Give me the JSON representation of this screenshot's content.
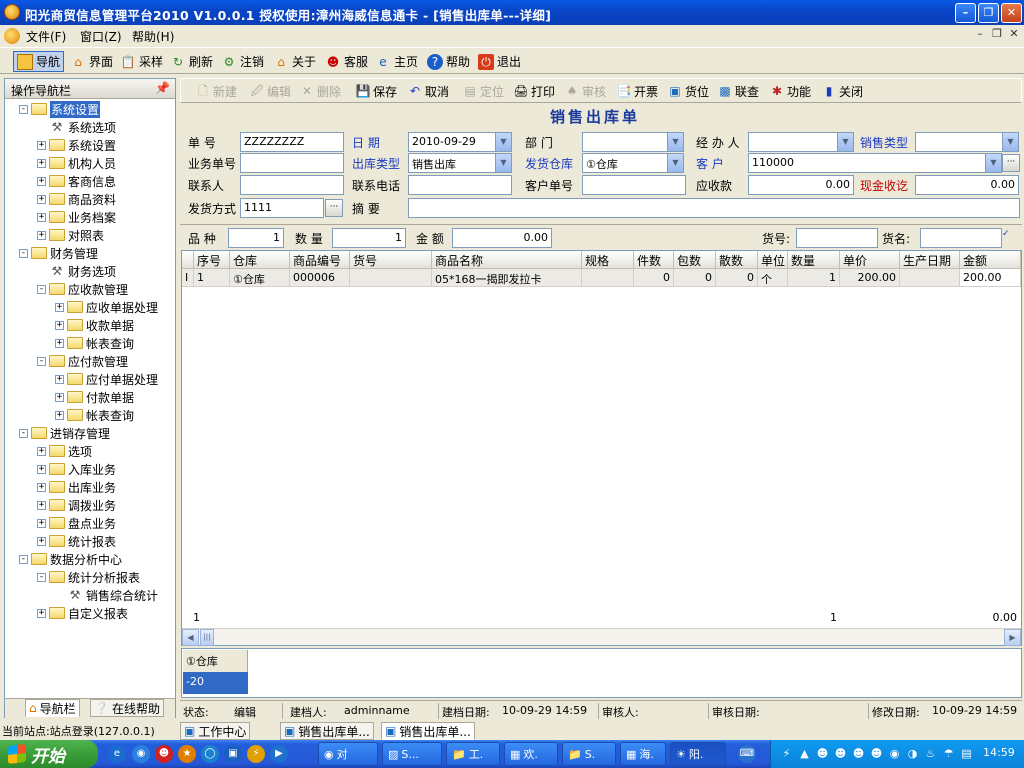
{
  "window": {
    "title": "阳光商贸信息管理平台2010   V1.0.0.1  授权使用:漳州海威信息通卡 - [销售出库单---详细]"
  },
  "menu": {
    "file": "文件(F)",
    "window": "窗口(Z)",
    "help": "帮助(H)"
  },
  "maintoolbar": {
    "items": [
      "导航",
      "界面",
      "采样",
      "刷新",
      "注销",
      "关于",
      "客服",
      "主页",
      "帮助",
      "退出"
    ]
  },
  "nav": {
    "header": "操作导航栏",
    "items": [
      {
        "label": "系统设置",
        "pm": "−"
      },
      {
        "label": "系统选项"
      },
      {
        "label": "系统设置",
        "pm": "+"
      },
      {
        "label": "机构人员",
        "pm": "+"
      },
      {
        "label": "客商信息",
        "pm": "+"
      },
      {
        "label": "商品资料",
        "pm": "+"
      },
      {
        "label": "业务档案",
        "pm": "+"
      },
      {
        "label": "对照表",
        "pm": "+"
      },
      {
        "label": "财务管理",
        "pm": "−"
      },
      {
        "label": "财务选项"
      },
      {
        "label": "应收款管理",
        "pm": "−"
      },
      {
        "label": "应收单据处理",
        "pm": "+"
      },
      {
        "label": "收款单据",
        "pm": "+"
      },
      {
        "label": "帐表查询",
        "pm": "+"
      },
      {
        "label": "应付款管理",
        "pm": "−"
      },
      {
        "label": "应付单据处理",
        "pm": "+"
      },
      {
        "label": "付款单据",
        "pm": "+"
      },
      {
        "label": "帐表查询",
        "pm": "+"
      },
      {
        "label": "进销存管理",
        "pm": "−"
      },
      {
        "label": "选项",
        "pm": "+"
      },
      {
        "label": "入库业务",
        "pm": "+"
      },
      {
        "label": "出库业务",
        "pm": "+"
      },
      {
        "label": "调拨业务",
        "pm": "+"
      },
      {
        "label": "盘点业务",
        "pm": "+"
      },
      {
        "label": "统计报表",
        "pm": "+"
      },
      {
        "label": "数据分析中心",
        "pm": "−"
      },
      {
        "label": "统计分析报表",
        "pm": "−"
      },
      {
        "label": "销售综合统计"
      },
      {
        "label": "自定义报表",
        "pm": "+"
      }
    ],
    "tab_nav": "导航栏",
    "tab_help": "在线帮助"
  },
  "formtoolbar": {
    "new": "新建",
    "edit": "编辑",
    "delete": "删除",
    "save": "保存",
    "cancel": "取消",
    "locate": "定位",
    "print": "打印",
    "audit": "审核",
    "invoice": "开票",
    "slot": "货位",
    "query": "联查",
    "func": "功能",
    "close": "关闭"
  },
  "form": {
    "title": "销售出库单",
    "labels": {
      "doc_no": "单   号",
      "date": "日   期",
      "dept": "部   门",
      "handler": "经 办 人",
      "sale_type": "销售类型",
      "biz_no": "业务单号",
      "out_type": "出库类型",
      "ship_wh": "发货仓库",
      "customer": "客   户",
      "contact": "联系人",
      "phone": "联系电话",
      "cust_no": "客户单号",
      "receivable": "应收款",
      "cash": "现金收讫",
      "ship_way": "发货方式",
      "memo": "摘   要"
    },
    "values": {
      "doc_no": "ZZZZZZZZ",
      "date": "2010-09-29",
      "dept": "",
      "handler": "",
      "sale_type": "",
      "biz_no": "",
      "out_type": "销售出库",
      "ship_wh": "①仓库",
      "customer": "110000",
      "contact": "",
      "phone": "",
      "cust_no": "",
      "receivable": "0.00",
      "cash": "0.00",
      "ship_way": "1111",
      "memo": ""
    }
  },
  "summary": {
    "kinds_label": "品 种",
    "kinds": "1",
    "qty_label": "数 量",
    "qty": "1",
    "amount_label": "金 额",
    "amount": "0.00",
    "goods_no_label": "货号:",
    "goods_name_label": "货名:"
  },
  "grid": {
    "columns": [
      "序号",
      "仓库",
      "商品编号",
      "货号",
      "商品名称",
      "规格",
      "件数",
      "包数",
      "散数",
      "单位",
      "数量",
      "单价",
      "生产日期",
      "金额"
    ],
    "rows": [
      [
        "1",
        "①仓库",
        "000006",
        "",
        "05*168一揭即发拉卡",
        "",
        "0",
        "0",
        "0",
        "个",
        "1",
        "200.00",
        "",
        "200.00"
      ]
    ],
    "footer": {
      "count": "1",
      "qty": "1",
      "amount": "0.00"
    }
  },
  "stock": {
    "warehouse": "①仓库",
    "value": "-20"
  },
  "status": {
    "state_label": "状态:",
    "state": "编辑",
    "creator_label": "建档人:",
    "creator": "adminname",
    "created_label": "建档日期:",
    "created": "10-09-29 14:59",
    "auditor_label": "审核人:",
    "audit_date_label": "审核日期:",
    "modified_label": "修改日期:",
    "modified": "10-09-29 14:59"
  },
  "site": {
    "text": "当前站点:站点登录(127.0.0.1)"
  },
  "windowtabs": [
    "工作中心",
    "销售出库单...",
    "销售出库单..."
  ],
  "taskbar": {
    "start": "开始",
    "tasks": [
      "对",
      "S...",
      "工.",
      "欢.",
      "S.",
      "海.",
      "阳."
    ],
    "clock": "14:59"
  }
}
